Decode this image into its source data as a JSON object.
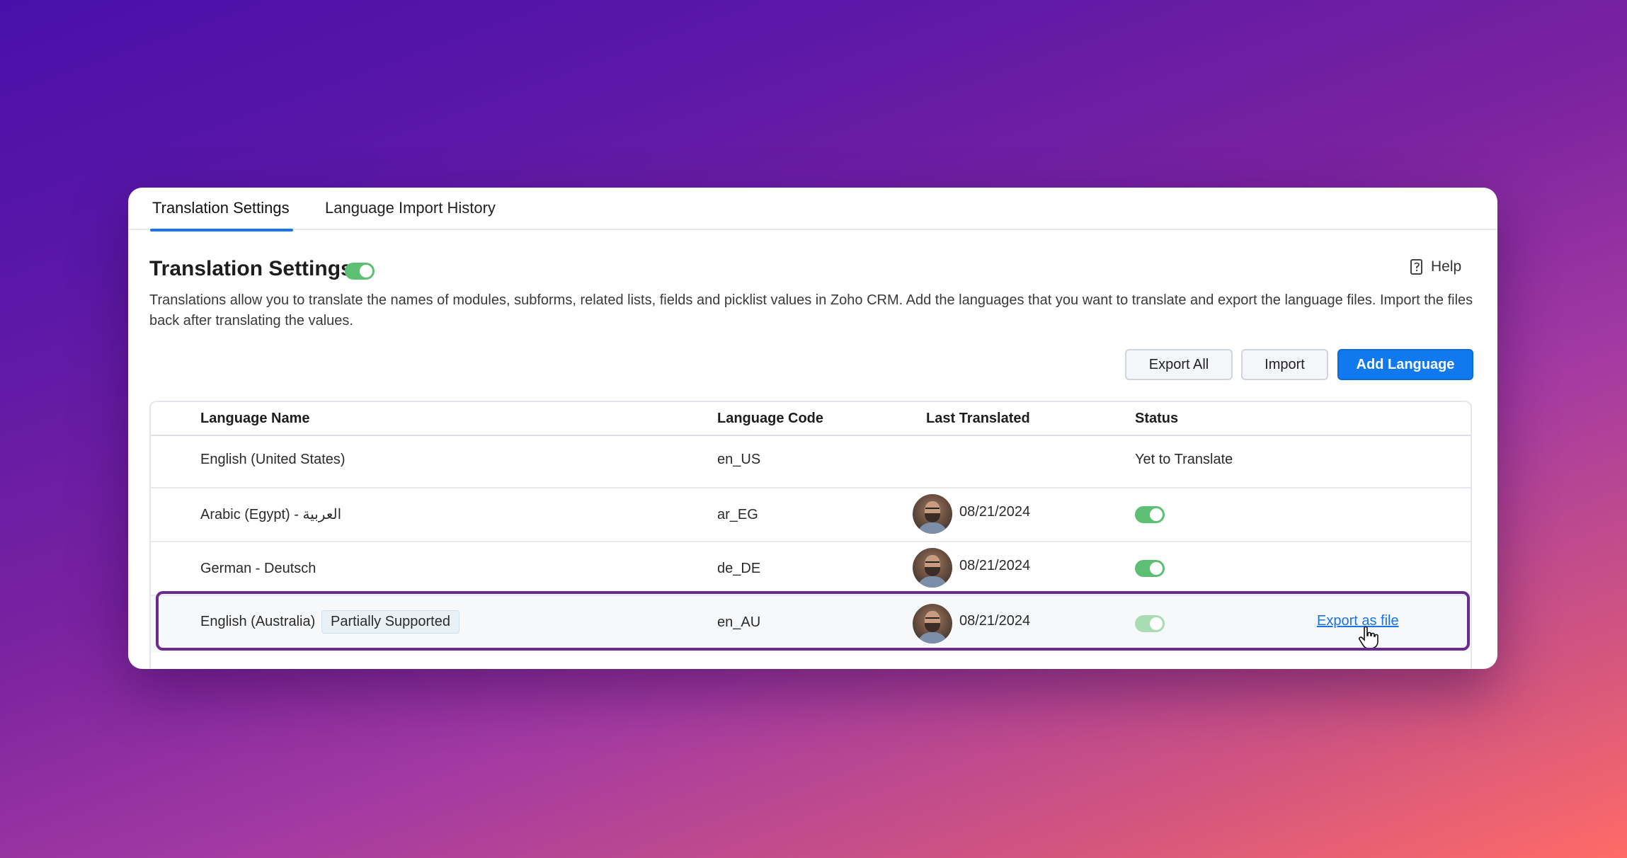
{
  "tabs": [
    {
      "label": "Translation Settings",
      "active": true
    },
    {
      "label": "Language Import History",
      "active": false
    }
  ],
  "header": {
    "title": "Translation Settings",
    "enabled": true,
    "help_label": "Help",
    "description": "Translations allow you to translate the names of modules, subforms, related lists, fields and picklist values in Zoho CRM. Add the languages that you want to translate and export the language files. Import the files back after translating the values."
  },
  "actions": {
    "export_all": "Export All",
    "import": "Import",
    "add_language": "Add Language"
  },
  "table": {
    "columns": [
      "Language Name",
      "Language Code",
      "Last Translated",
      "Status"
    ],
    "rows": [
      {
        "name": "English (United States)",
        "code": "en_US",
        "last_translated": "",
        "status_text": "Yet to Translate"
      },
      {
        "name": "Arabic (Egypt) - العربية",
        "code": "ar_EG",
        "last_translated": "08/21/2024",
        "status_enabled": true
      },
      {
        "name": "German - Deutsch",
        "code": "de_DE",
        "last_translated": "08/21/2024",
        "status_enabled": true
      },
      {
        "name": "English (Australia)",
        "badge": "Partially Supported",
        "code": "en_AU",
        "last_translated": "08/21/2024",
        "status_enabled": true,
        "action": "Export as file"
      }
    ]
  },
  "colors": {
    "accent": "#1179f0",
    "toggle_on": "#5cbf73",
    "highlight_border": "#6a2a8e",
    "link": "#1a73e8"
  },
  "icons": [
    "help-document-icon",
    "avatar",
    "hand-pointer-cursor-icon"
  ]
}
